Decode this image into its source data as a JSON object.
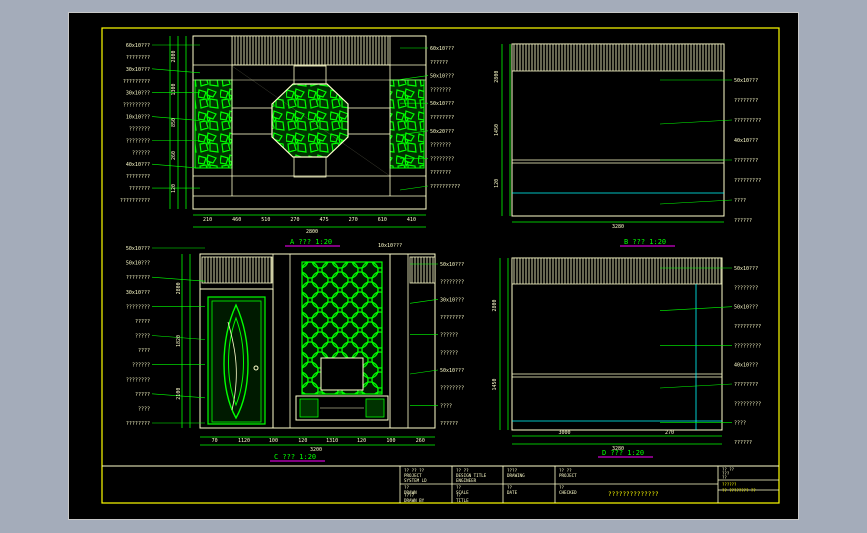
{
  "window": {
    "background": "#a4acba",
    "canvas_color": "#000000"
  },
  "colors": {
    "frame": "#ffff00",
    "panel_line": "#ffffcc",
    "accent_green": "#00ff00",
    "cyan": "#00ffff",
    "magenta": "#ff00ff",
    "title_text": "#ffff00"
  },
  "elevations": {
    "a": {
      "caption": "A ??? 1:20",
      "total_width": "2800",
      "dims": [
        "210",
        "460",
        "510",
        "270",
        "475",
        "270",
        "610",
        "410"
      ],
      "tags": [
        "60x10???",
        "??????",
        "50x10???",
        "???????",
        "50x10???",
        "????????",
        "50x20???",
        "???????",
        "????????",
        "???????",
        "??????????"
      ],
      "left_tags": [
        "60x10???",
        "????????",
        "30x10???",
        "?????????",
        "30x10???",
        "?????????",
        "10x10???",
        "???????",
        "????????",
        "??????",
        "40x10???",
        "????????",
        "???????",
        "??????????"
      ],
      "height_dims": [
        "2800",
        "1300",
        "850",
        "260",
        "120"
      ]
    },
    "b": {
      "caption": "B ??? 1:20",
      "width": "3280",
      "tags": [
        "50x10???",
        "????????",
        "?????????",
        "40x10???",
        "????????",
        "?????????",
        "????",
        "??????"
      ],
      "height_dims": [
        "2800",
        "1450",
        "120"
      ]
    },
    "c": {
      "caption": "C ??? 1:20",
      "total_width": "3200",
      "dims": [
        "70",
        "1120",
        "100",
        "120",
        "1310",
        "120",
        "100",
        "260"
      ],
      "top_tag": "10x10???",
      "left_tags": [
        "50x10???",
        "50x10???",
        "????????",
        "30x10???",
        "????????",
        "?????",
        "?????",
        "????",
        "??????",
        "????????",
        "?????",
        "????",
        "????????"
      ],
      "right_tags": [
        "50x10???",
        "????????",
        "30x10???",
        "????????",
        "??????",
        "??????",
        "50x10???",
        "????????",
        "????",
        "??????"
      ],
      "height_dims": [
        "2800",
        "1820",
        "2100"
      ]
    },
    "d": {
      "caption": "D ??? 1:20",
      "width": "3280",
      "dims": [
        "3000",
        "270"
      ],
      "tags": [
        "50x10???",
        "????????",
        "50x10???",
        "?????????",
        "?????????",
        "40x10???",
        "????????",
        "?????????",
        "????",
        "??????"
      ],
      "height_dims": [
        "2800",
        "1450"
      ]
    }
  },
  "title_block": {
    "cells": [
      [
        "?? ?? ??",
        "PROJECT",
        "SYSTEM LD"
      ],
      [
        "?? ??",
        "DESIGN TITLE",
        "ENGINEER"
      ],
      [
        "????",
        "DRAWING"
      ],
      [
        "?? ??",
        "PROJECT"
      ],
      [
        "??",
        "DRAWN"
      ],
      [
        "??",
        "SCALE"
      ],
      [
        "??",
        "DATE"
      ],
      [
        "??",
        "CHECKED"
      ],
      [
        "????",
        "DRAWN BY"
      ],
      [
        "??",
        "TITLE"
      ]
    ],
    "center_title": "??????????????",
    "right_top": [
      "?? ??",
      "???",
      "??"
    ],
    "right_bottom": [
      "??????",
      "?? ???????? ??"
    ]
  }
}
